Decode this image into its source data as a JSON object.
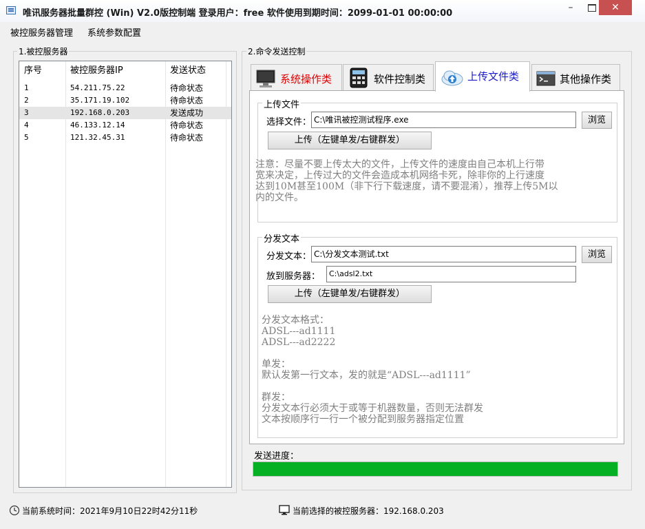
{
  "window": {
    "title": "唯讯服务器批量群控 (Win) V2.0版控制端   登录用户：free   软件使用到期时间：2099-01-01 00:00:00",
    "minimize": "–",
    "close": "✕"
  },
  "menu": {
    "items": [
      "被控服务器管理",
      "系统参数配置"
    ]
  },
  "server_group": {
    "title": "1.被控服务器",
    "columns": [
      "序号",
      "被控服务器IP",
      "发送状态"
    ],
    "rows": [
      [
        "1",
        "54.211.75.22",
        "待命状态"
      ],
      [
        "2",
        "35.171.19.102",
        "待命状态"
      ],
      [
        "3",
        "192.168.0.203",
        "发送成功"
      ],
      [
        "4",
        "46.133.12.14",
        "待命状态"
      ],
      [
        "5",
        "121.32.45.31",
        "待命状态"
      ]
    ],
    "selected_row": 3
  },
  "command_group": {
    "title": "2.命令发送控制",
    "tabs": [
      {
        "label": "系统操作类",
        "icon": "monitor-icon",
        "color": "#e00000"
      },
      {
        "label": "软件控制类",
        "icon": "calculator-icon",
        "color": "#000000"
      },
      {
        "label": "上传文件类",
        "icon": "cloud-upload-icon",
        "color": "#1a1ac8"
      },
      {
        "label": "其他操作类",
        "icon": "console-icon",
        "color": "#000000"
      }
    ],
    "active_tab": 2
  },
  "upload": {
    "group_title": "上传文件",
    "select_label": "选择文件：",
    "file_value": "C:\\唯讯被控测试程序.exe",
    "browse_label": "浏览",
    "upload_button": "上传（左键单发/右键群发）",
    "note_lines": [
      "注意：尽量不要上传太大的文件，上传文件的速度由自己本机上行带",
      "宽来决定，上传过大的文件会造成本机网络卡死，除非你的上行速度",
      "达到10M甚至100M（非下行下载速度，请不要混淆），推荐上传5M以",
      "内的文件。"
    ]
  },
  "distribute": {
    "group_title": "分发文本",
    "text_label": "分发文本：",
    "text_value": "C:\\分发文本测试.txt",
    "browse_label": "浏览",
    "dest_label": "放到服务器：",
    "dest_value": "C:\\adsl2.txt",
    "upload_button": "上传（左键单发/右键群发）",
    "format_lines": [
      "分发文本格式：",
      "ADSL---ad1111",
      "ADSL---ad2222",
      "",
      "单发：",
      "默认发第一行文本，发的就是“ADSL---ad1111”",
      "",
      "群发：",
      "分发文本行必须大于或等于机器数量，否则无法群发",
      "文本按顺序行一行一个被分配到服务器指定位置"
    ]
  },
  "progress": {
    "label": "发送进度：",
    "percent": 100,
    "color": "#06b025"
  },
  "status": {
    "time": "当前系统时间：2021年9月10日22时42分11秒",
    "server": "当前选择的被控服务器：192.168.0.203"
  }
}
